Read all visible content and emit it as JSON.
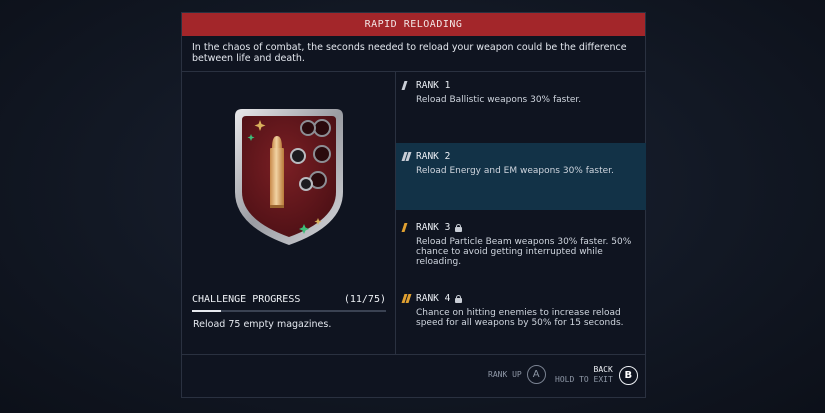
{
  "skill": {
    "title": "RAPID RELOADING",
    "description": "In the chaos of combat, the seconds needed to reload your weapon could be the difference between life and death."
  },
  "challenge": {
    "label": "CHALLENGE PROGRESS",
    "count": "(11/75)",
    "progress_fraction": 0.147,
    "description": "Reload 75 empty magazines."
  },
  "ranks": [
    {
      "title": "RANK 1",
      "description": "Reload Ballistic weapons 30% faster.",
      "locked": false,
      "active": false,
      "icon_color": "#c9ced6",
      "icon": "rank-1-icon"
    },
    {
      "title": "RANK 2",
      "description": "Reload Energy and EM weapons 30% faster.",
      "locked": false,
      "active": true,
      "icon_color": "#c9ced6",
      "icon": "rank-2-icon"
    },
    {
      "title": "RANK 3",
      "description": "Reload Particle Beam weapons 30% faster. 50% chance to avoid getting interrupted while reloading.",
      "locked": true,
      "active": false,
      "icon_color": "#e0a030",
      "icon": "rank-3-icon"
    },
    {
      "title": "RANK 4",
      "description": "Chance on hitting enemies to increase reload speed for all weapons by 50% for 15 seconds.",
      "locked": true,
      "active": false,
      "icon_color": "#e0a030",
      "icon": "rank-4-icon"
    }
  ],
  "footer": {
    "rank_up_label": "RANK UP",
    "rank_up_key": "A",
    "back_label": "BACK",
    "hold_label": "HOLD TO EXIT",
    "back_key": "B"
  },
  "colors": {
    "title_bar": "#a3262a",
    "active_rank": "#123247",
    "locked_rank_icon": "#e0a030"
  }
}
